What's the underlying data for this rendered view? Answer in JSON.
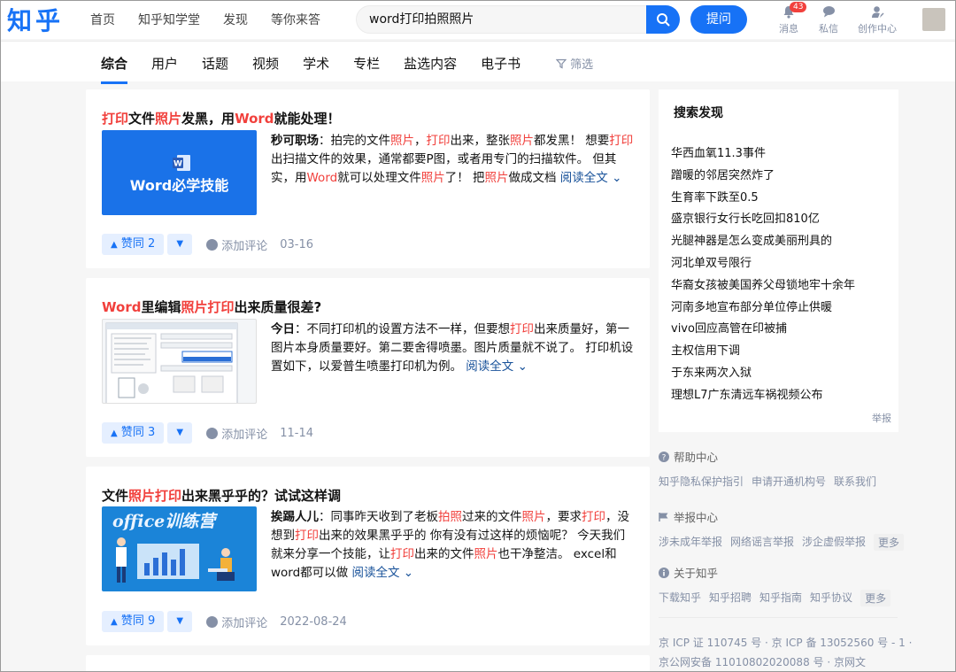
{
  "header": {
    "logo": "知乎",
    "nav": [
      "首页",
      "知乎知学堂",
      "发现",
      "等你来答"
    ],
    "search_value": "word打印拍照照片",
    "ask_label": "提问",
    "icons": [
      {
        "name": "bell-icon",
        "label": "消息",
        "badge": "43"
      },
      {
        "name": "chat-icon",
        "label": "私信"
      },
      {
        "name": "creator-icon",
        "label": "创作中心"
      }
    ]
  },
  "tabs": [
    "综合",
    "用户",
    "话题",
    "视频",
    "学术",
    "专栏",
    "盐选内容",
    "电子书"
  ],
  "filter_label": "筛选",
  "results": [
    {
      "title_parts": [
        "打印",
        "文件",
        "照片",
        "发黑，用",
        "Word",
        "就能处理！"
      ],
      "title_hl": [
        true,
        false,
        true,
        false,
        true,
        false
      ],
      "author": "秒可职场",
      "excerpt_parts": [
        "：拍完的文件",
        "照片",
        "，",
        "打印",
        "出来，整张",
        "照片",
        "都发黑！ 想要",
        "打印",
        "出扫描文件的效果，通常都要P图，或者用专门的扫描软件。 但其实，用",
        "Word",
        "就可以处理文件",
        "照片",
        "了！ 把",
        "照片",
        "做成文档 "
      ],
      "excerpt_hl": [
        false,
        true,
        false,
        true,
        false,
        true,
        false,
        true,
        false,
        true,
        false,
        true,
        false,
        true,
        false
      ],
      "read_more": "阅读全文",
      "thumb_text": "Word必学技能",
      "vote": "赞同 2",
      "comment": "添加评论",
      "date": "03-16"
    },
    {
      "title_parts": [
        "Word",
        "里编辑",
        "照片",
        "打印",
        "出来质量很差?"
      ],
      "title_hl": [
        true,
        false,
        true,
        true,
        false
      ],
      "author": "今日",
      "excerpt_parts": [
        "：不同打印机的设置方法不一样，但要想",
        "打印",
        "出来质量好，第一图片本身质量要好。第二要舍得喷墨。图片质量就不说了。 打印机设置如下，以爱普生喷墨打印机为例。 "
      ],
      "excerpt_hl": [
        false,
        true,
        false
      ],
      "read_more": "阅读全文",
      "vote": "赞同 3",
      "comment": "添加评论",
      "date": "11-14"
    },
    {
      "title_parts": [
        "文件",
        "照片",
        "打印",
        "出来黑乎乎的？试试这样调"
      ],
      "title_hl": [
        false,
        true,
        true,
        false
      ],
      "author": "挨踢人儿",
      "excerpt_parts": [
        "：同事昨天收到了老板",
        "拍照",
        "过来的文件",
        "照片",
        "，要求",
        "打印",
        "，没想到",
        "打印",
        "出来的效果黑乎乎的 你有没有过这样的烦恼呢？ 今天我们就来分享一个技能，让",
        "打印",
        "出来的文件",
        "照片",
        "也干净整洁。 excel和word都可以做 "
      ],
      "excerpt_hl": [
        false,
        true,
        false,
        true,
        false,
        true,
        false,
        true,
        false,
        true,
        false,
        true,
        false
      ],
      "read_more": "阅读全文",
      "thumb_text": "office训练营",
      "vote": "赞同 9",
      "comment": "添加评论",
      "date": "2022-08-24"
    }
  ],
  "sidebar": {
    "title": "搜索发现",
    "items": [
      "华西血氧11.3事件",
      "蹭暖的邻居突然炸了",
      "生育率下跌至0.5",
      "盛京银行女行长吃回扣810亿",
      "光腿神器是怎么变成美丽刑具的",
      "河北单双号限行",
      "华裔女孩被美国养父母锁地牢十余年",
      "河南多地宣布部分单位停止供暖",
      "vivo回应高管在印被捕",
      "主权信用下调",
      "于东来两次入狱",
      "理想L7广东清远车祸视频公布"
    ],
    "report": "举报"
  },
  "footer": {
    "help_title": "帮助中心",
    "help_links": [
      "知乎隐私保护指引",
      "申请开通机构号",
      "联系我们"
    ],
    "report_title": "举报中心",
    "report_links": [
      "涉未成年举报",
      "网络谣言举报",
      "涉企虚假举报"
    ],
    "about_title": "关于知乎",
    "about_links": [
      "下载知乎",
      "知乎招聘",
      "知乎指南",
      "知乎协议"
    ],
    "more": "更多",
    "icp1": "京 ICP 证 110745 号 · 京 ICP 备 13052560 号 - 1 ·",
    "icp2": "京公网安备 11010802020088 号 · 京网文"
  },
  "colors": {
    "brand": "#1772f6",
    "highlight": "#f1403c",
    "link": "#175199",
    "muted": "#8590a6"
  }
}
